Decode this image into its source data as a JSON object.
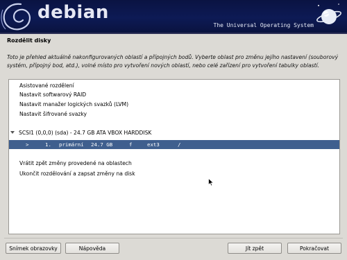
{
  "banner": {
    "logo_text": "debian",
    "tagline": "The Universal Operating System"
  },
  "page": {
    "title": "Rozdělit disky",
    "description": "Toto je přehled aktuálně nakonfigurovaných oblastí a přípojných bodů. Vyberte oblast pro změnu jejího nastavení (souborový systém, přípojný bod, atd.), volné místo pro vytvoření nových oblastí, nebo celé zařízení pro vytvoření tabulky oblastí."
  },
  "list": {
    "items_top": [
      "Asistované rozdělení",
      "Nastavit softwarový RAID",
      "Nastavit manažer logických svazků (LVM)",
      "Nastavit šifrované svazky"
    ],
    "disk": "SCSI1 (0,0,0) (sda) - 24.7 GB ATA VBOX HARDDISK",
    "partition": {
      "marker": ">",
      "number": "1.",
      "type": "primární",
      "size": "24.7 GB",
      "flag": "f",
      "fs": "ext3",
      "mount": "/"
    },
    "items_bottom": [
      "Vrátit zpět změny provedené na oblastech",
      "Ukončit rozdělování a zapsat změny na disk"
    ]
  },
  "buttons": {
    "screenshot": "Snímek obrazovky",
    "help": "Nápověda",
    "back": "Jít zpět",
    "continue": "Pokračovat"
  },
  "colors": {
    "banner_bg": "#0d1a55",
    "selection": "#3f5f8e",
    "window_bg": "#dcdad5"
  }
}
